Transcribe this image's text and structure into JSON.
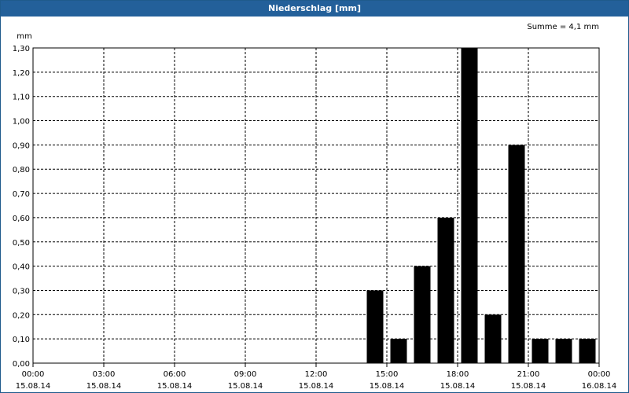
{
  "window": {
    "title": "Niederschlag [mm]"
  },
  "chart_data": {
    "type": "bar",
    "title": "Niederschlag [mm]",
    "ylabel": "mm",
    "annotation": "Summe = 4,1 mm",
    "ylim": [
      0,
      1.3
    ],
    "y_ticks": [
      "0,00",
      "0,10",
      "0,20",
      "0,30",
      "0,40",
      "0,50",
      "0,60",
      "0,70",
      "0,80",
      "0,90",
      "1,00",
      "1,10",
      "1,20",
      "1,30"
    ],
    "x_ticks": [
      {
        "time": "00:00",
        "date": "15.08.14"
      },
      {
        "time": "03:00",
        "date": "15.08.14"
      },
      {
        "time": "06:00",
        "date": "15.08.14"
      },
      {
        "time": "09:00",
        "date": "15.08.14"
      },
      {
        "time": "12:00",
        "date": "15.08.14"
      },
      {
        "time": "15:00",
        "date": "15.08.14"
      },
      {
        "time": "18:00",
        "date": "15.08.14"
      },
      {
        "time": "21:00",
        "date": "15.08.14"
      },
      {
        "time": "00:00",
        "date": "16.08.14"
      }
    ],
    "bar_color": "#000000",
    "grid": true,
    "bars": [
      {
        "hour": 14,
        "value": 0.3
      },
      {
        "hour": 15,
        "value": 0.1
      },
      {
        "hour": 16,
        "value": 0.4
      },
      {
        "hour": 17,
        "value": 0.6
      },
      {
        "hour": 18,
        "value": 1.3
      },
      {
        "hour": 19,
        "value": 0.2
      },
      {
        "hour": 20,
        "value": 0.9
      },
      {
        "hour": 21,
        "value": 0.1
      },
      {
        "hour": 22,
        "value": 0.1
      },
      {
        "hour": 23,
        "value": 0.1
      }
    ]
  }
}
